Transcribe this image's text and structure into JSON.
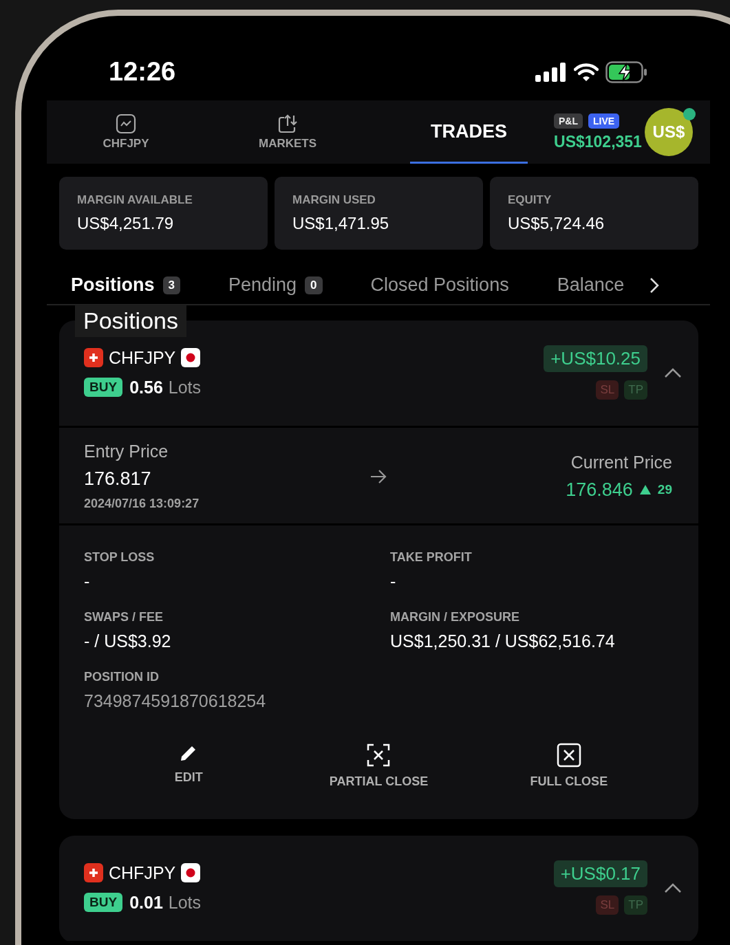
{
  "status_bar": {
    "time": "12:26"
  },
  "nav": {
    "items": [
      {
        "kind": "chart",
        "label": "CHFJPY",
        "selected": false
      },
      {
        "kind": "markets",
        "label": "MARKETS",
        "selected": false
      },
      {
        "kind": "text",
        "label": "TRADES",
        "selected": true
      }
    ],
    "pnl": {
      "badge": "P&L",
      "live_badge": "LIVE",
      "value": "US$102,351"
    },
    "avatar": {
      "label": "US$",
      "online": true
    }
  },
  "summary": [
    {
      "label": "MARGIN AVAILABLE",
      "value": "US$4,251.79"
    },
    {
      "label": "MARGIN USED",
      "value": "US$1,471.95"
    },
    {
      "label": "EQUITY",
      "value": "US$5,724.46"
    }
  ],
  "tabs": [
    {
      "label": "Positions",
      "count": "3",
      "selected": true
    },
    {
      "label": "Pending",
      "count": "0",
      "selected": false
    },
    {
      "label": "Closed Positions",
      "selected": false
    },
    {
      "label": "Balance",
      "selected": false
    }
  ],
  "tooltip": "Positions",
  "positions": [
    {
      "symbol": "CHFJPY",
      "side": "BUY",
      "lots": "0.56",
      "lots_unit": "Lots",
      "pnl": "+US$10.25",
      "sl": "SL",
      "tp": "TP",
      "details": {
        "entry_label": "Entry Price",
        "entry_price": "176.817",
        "entry_time": "2024/07/16 13:09:27",
        "current_label": "Current Price",
        "current_price": "176.846",
        "change": "29",
        "fields": [
          {
            "label": "STOP LOSS",
            "value": "-"
          },
          {
            "label": "TAKE PROFIT",
            "value": "-"
          },
          {
            "label": "SWAPS / FEE",
            "value": "- / US$3.92"
          },
          {
            "label": "MARGIN / EXPOSURE",
            "value": "US$1,250.31 / US$62,516.74"
          },
          {
            "label": "POSITION ID",
            "value": "7349874591870618254",
            "muted": true
          }
        ],
        "actions": [
          {
            "kind": "edit",
            "label": "EDIT"
          },
          {
            "kind": "partial",
            "label": "PARTIAL CLOSE"
          },
          {
            "kind": "full",
            "label": "FULL CLOSE"
          }
        ]
      }
    },
    {
      "symbol": "CHFJPY",
      "side": "BUY",
      "lots": "0.01",
      "lots_unit": "Lots",
      "pnl": "+US$0.17",
      "sl": "SL",
      "tp": "TP"
    }
  ]
}
